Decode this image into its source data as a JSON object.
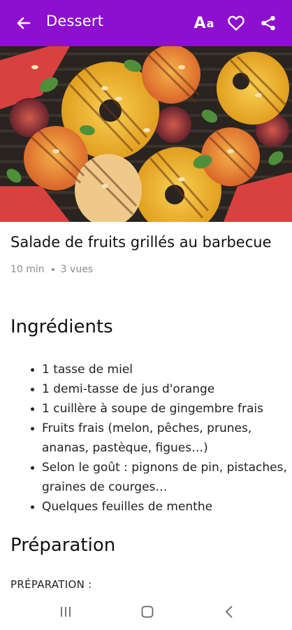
{
  "appbar": {
    "title": "Dessert",
    "font_button_big": "A",
    "font_button_small": "a"
  },
  "hero": {
    "icon": "grilled-fruit-photo"
  },
  "recipe": {
    "title": "Salade de fruits grillés au barbecue",
    "duration": "10 min",
    "views": "3 vues"
  },
  "ingredients": {
    "heading": "Ingrédients",
    "items": [
      "1 tasse de miel",
      "1 demi-tasse de jus d'orange",
      "1 cuillère à soupe de gingembre frais",
      "Fruits frais (melon, pêches, prunes, ananas, pastèque, figues…)",
      "Selon le goût : pignons de pin, pistaches, graines de courges…",
      "Quelques feuilles de menthe"
    ]
  },
  "preparation": {
    "heading": "Préparation",
    "label": "PRÉPARATION :"
  },
  "colors": {
    "primary": "#8e0fd0"
  }
}
